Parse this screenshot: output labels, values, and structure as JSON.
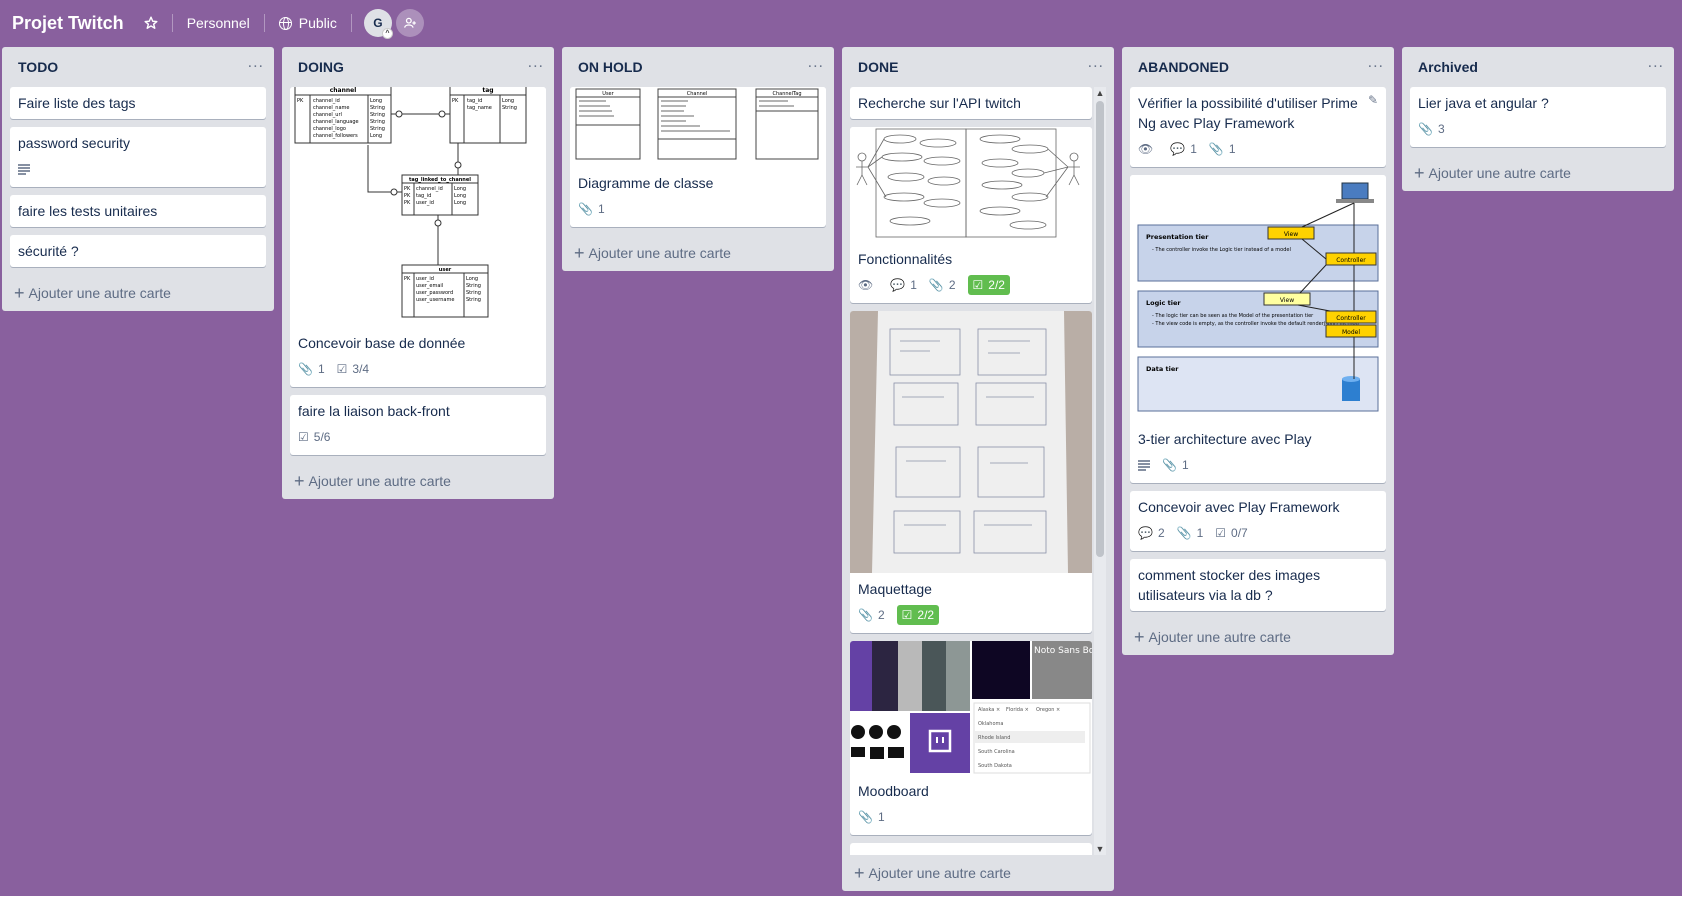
{
  "board": {
    "title": "Projet Twitch",
    "team": "Personnel",
    "visibility": "Public",
    "member_initial": "G"
  },
  "lists": {
    "todo": {
      "title": "TODO",
      "add_card": "Ajouter une autre carte",
      "cards": [
        {
          "title": "Faire liste des tags"
        },
        {
          "title": "password security"
        },
        {
          "title": "faire les tests unitaires"
        },
        {
          "title": "sécurité ?"
        }
      ]
    },
    "doing": {
      "title": "DOING",
      "add_card": "Ajouter une autre carte",
      "cards": [
        {
          "title": "Concevoir base de donnée",
          "attachments": "1",
          "checklist": "3/4"
        },
        {
          "title": "faire la liaison back-front",
          "checklist": "5/6"
        }
      ]
    },
    "on_hold": {
      "title": "ON HOLD",
      "add_card": "Ajouter une autre carte",
      "cards": [
        {
          "title": "Diagramme de classe",
          "attachments": "1"
        }
      ]
    },
    "done": {
      "title": "DONE",
      "add_card": "Ajouter une autre carte",
      "cards": [
        {
          "title": "Recherche sur l'API twitch"
        },
        {
          "title": "Fonctionnalités",
          "comments": "1",
          "attachments": "2",
          "checklist": "2/2"
        },
        {
          "title": "Maquettage",
          "attachments": "2",
          "checklist": "2/2"
        },
        {
          "title": "Moodboard",
          "attachments": "1"
        }
      ]
    },
    "abandoned": {
      "title": "ABANDONED",
      "add_card": "Ajouter une autre carte",
      "cards": [
        {
          "title": "Vérifier la possibilité d'utiliser Prime Ng avec Play Framework",
          "comments": "1",
          "attachments": "1"
        },
        {
          "title": "3-tier architecture avec Play",
          "attachments": "1"
        },
        {
          "title": "Concevoir avec Play Framework",
          "comments": "2",
          "attachments": "1",
          "checklist": "0/7"
        },
        {
          "title": "comment stocker des images utilisateurs via la db ?"
        }
      ]
    },
    "archived": {
      "title": "Archived",
      "add_card": "Ajouter une autre carte",
      "cards": [
        {
          "title": "Lier java et angular ?",
          "attachments": "3"
        }
      ]
    }
  },
  "covers": {
    "db_schema": {
      "tables": [
        "channel",
        "tag",
        "tag_linked_to_channel",
        "user"
      ],
      "pk": "PK",
      "long": "Long",
      "string": "String",
      "channel_fields": [
        "channel_id",
        "channel_name",
        "channel_url",
        "channel_language",
        "channel_logo",
        "channel_followers"
      ],
      "tag_fields": [
        "tag_id",
        "tag_name"
      ],
      "link_fields": [
        "channel_id",
        "tag_id",
        "user_id"
      ],
      "user_fields": [
        "user_id",
        "user_email",
        "user_password",
        "user_username"
      ]
    },
    "class_diagram": {
      "classes": [
        "User",
        "Channel",
        "ChannelTag"
      ]
    },
    "architecture": {
      "presentation": "Presentation tier",
      "presentation_note": "- The controller invoke the Logic tier instead of a model",
      "logic": "Logic tier",
      "logic_note1": "- The logic tier can be seen as the Model of the presentation tier",
      "logic_note2": "- The view code is empty, as the controller invoke the default renderjson() method",
      "data": "Data tier",
      "view": "View",
      "controller": "Controller",
      "model": "Model"
    },
    "moodboard": {
      "font_name": "Noto Sans Bo",
      "chips": [
        "Alaska ×",
        "Florida ×",
        "Oregon ×"
      ],
      "states": [
        "Oklahoma",
        "Rhode Island",
        "South Carolina",
        "South Dakota"
      ]
    }
  },
  "colors": {
    "board_bg": "#89609e",
    "list_bg": "#dfe1e6",
    "badge_green": "#61bd4f",
    "twitch_purple": "#6441a5"
  }
}
